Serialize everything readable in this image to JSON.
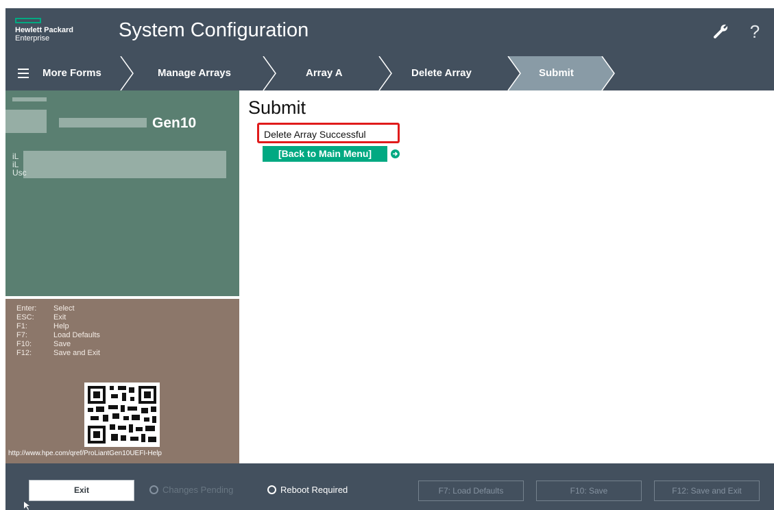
{
  "header": {
    "logo_line1": "Hewlett Packard",
    "logo_line2": "Enterprise",
    "title": "System Configuration",
    "settings_icon": "wrench-icon",
    "help_glyph": "?"
  },
  "breadcrumb": {
    "items": [
      {
        "label": "More Forms"
      },
      {
        "label": "Manage Arrays"
      },
      {
        "label": "Array A"
      },
      {
        "label": "Delete Array"
      },
      {
        "label": "Submit"
      }
    ],
    "active_color": "#899ba6"
  },
  "sidebar": {
    "server_model": "Gen10",
    "info_fragments": [
      "iL",
      "iL",
      "Usc"
    ],
    "keys": [
      {
        "key": "Enter:",
        "action": "Select"
      },
      {
        "key": "ESC:",
        "action": "Exit"
      },
      {
        "key": "F1:",
        "action": "Help"
      },
      {
        "key": "F7:",
        "action": "Load Defaults"
      },
      {
        "key": "F10:",
        "action": "Save"
      },
      {
        "key": "F12:",
        "action": "Save and Exit"
      }
    ],
    "help_url": "http://www.hpe.com/qref/ProLiantGen10UEFI-Help"
  },
  "main": {
    "title": "Submit",
    "message": "Delete Array Successful",
    "back_link": "[Back to Main Menu]"
  },
  "footer": {
    "exit_label": "Exit",
    "changes_pending": "Changes Pending",
    "reboot_required": "Reboot Required",
    "f7_label": "F7: Load Defaults",
    "f10_label": "F10: Save",
    "f12_label": "F12: Save and Exit"
  },
  "colors": {
    "header_bg": "#43505e",
    "accent_green": "#01a982",
    "sysinfo_bg": "#5a7f71",
    "keys_bg": "#8c776a",
    "highlight_red": "#e01b1b"
  }
}
